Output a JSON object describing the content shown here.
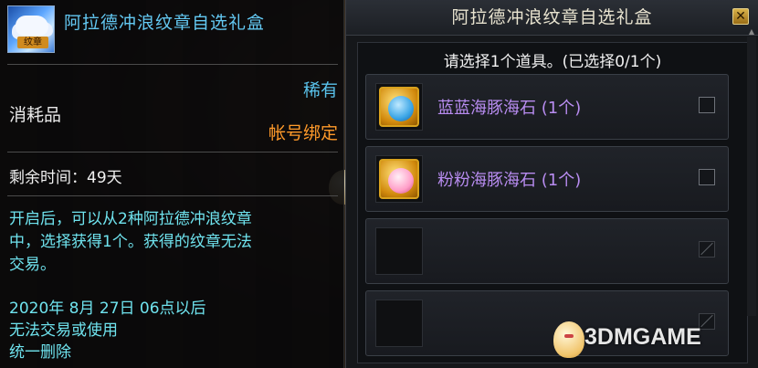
{
  "tooltip": {
    "badge_text": "纹章",
    "title": "阿拉德冲浪纹章自选礼盒",
    "rarity": "稀有",
    "category": "消耗品",
    "binding": "帐号绑定",
    "remaining_time": "剩余时间：49天",
    "description": "开启后，可以从2种阿拉德冲浪纹章\n中，选择获得1个。获得的纹章无法\n交易。",
    "expiry_note": "2020年 8月 27日 06点以后\n无法交易或使用\n统一删除"
  },
  "select_window": {
    "title": "阿拉德冲浪纹章自选礼盒",
    "prompt": "请选择1个道具。(已选择0/1个)",
    "items": [
      {
        "label": "蓝蓝海豚海石 (1个)",
        "icon": "blue-dolphin-gem-icon",
        "checked": false
      },
      {
        "label": "粉粉海豚海石 (1个)",
        "icon": "pink-dolphin-gem-icon",
        "checked": false
      },
      {
        "label": "",
        "icon": "",
        "checked": false,
        "disabled": true
      },
      {
        "label": "",
        "icon": "",
        "checked": false,
        "disabled": true
      }
    ]
  },
  "watermark": {
    "text": "3DMGAME"
  },
  "colors": {
    "title_blue": "#63c8f2",
    "binding_orange": "#ff9a2a",
    "desc_cyan": "#6fe3ee",
    "item_purple": "#b88cf0"
  }
}
